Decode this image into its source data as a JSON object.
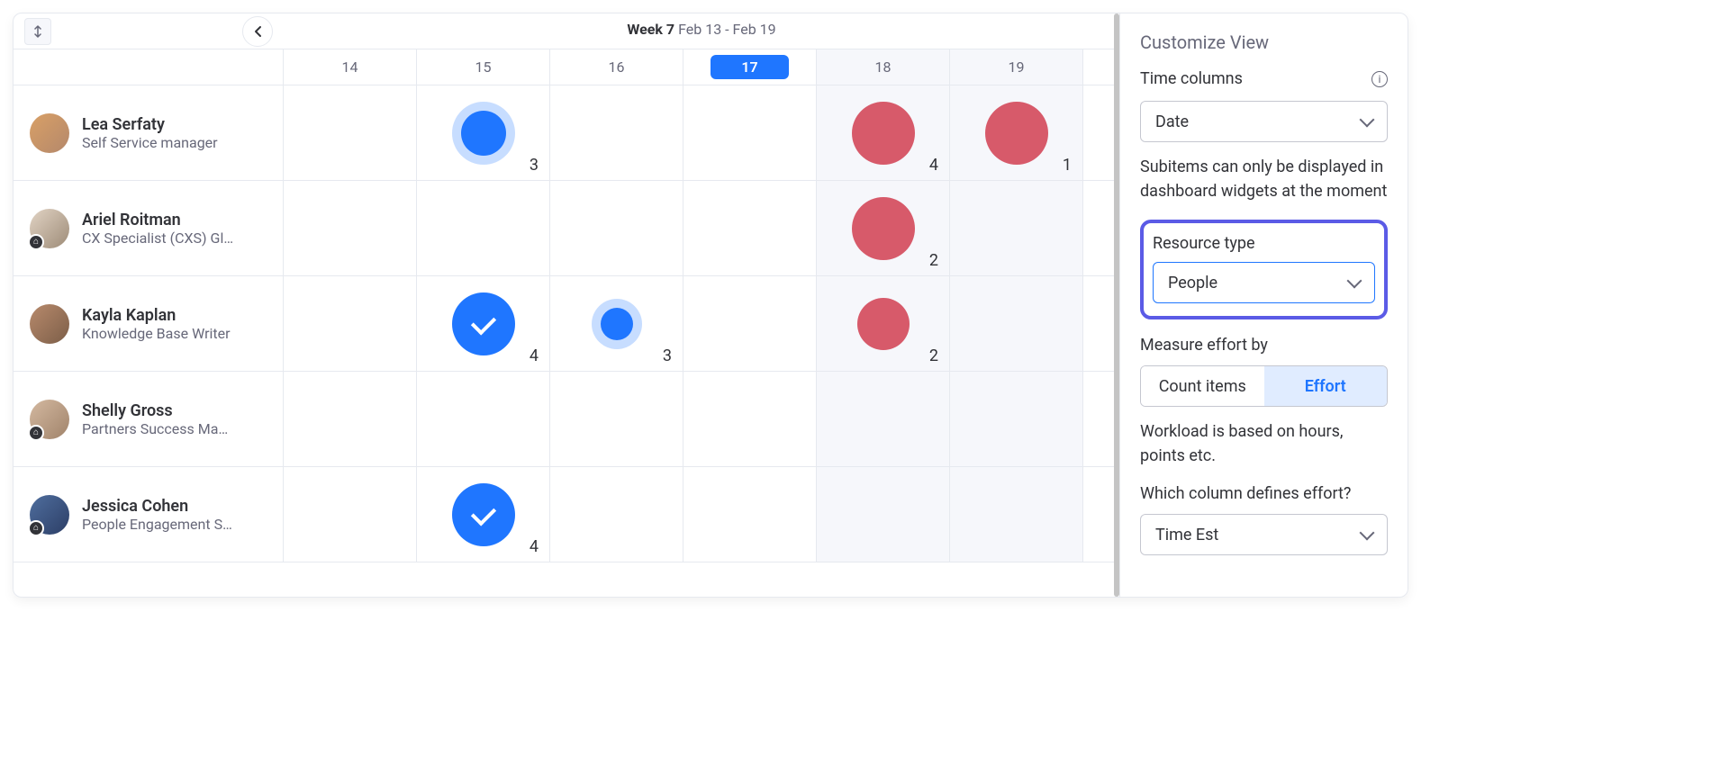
{
  "header": {
    "week_label": "Week 7",
    "range_label": "Feb 13 - Feb 19",
    "days": [
      {
        "num": "14",
        "weekend": false,
        "today": false
      },
      {
        "num": "15",
        "weekend": false,
        "today": false
      },
      {
        "num": "16",
        "weekend": false,
        "today": false
      },
      {
        "num": "17",
        "weekend": false,
        "today": true
      },
      {
        "num": "18",
        "weekend": true,
        "today": false
      },
      {
        "num": "19",
        "weekend": true,
        "today": false
      }
    ]
  },
  "people": [
    {
      "name": "Lea Serfaty",
      "role": "Self Service manager",
      "home_badge": false,
      "avatar": "a1",
      "cells": [
        {},
        {
          "dot": {
            "color": "blue",
            "size": "sz50",
            "ring": true
          },
          "count": "3"
        },
        {},
        {},
        {
          "dot": {
            "color": "red",
            "size": "sz70"
          },
          "count": "4",
          "weekend": true
        },
        {
          "dot": {
            "color": "red",
            "size": "sz70"
          },
          "count": "1",
          "weekend": true
        }
      ]
    },
    {
      "name": "Ariel Roitman",
      "role": "CX Specialist (CXS) Gl…",
      "home_badge": true,
      "avatar": "a2",
      "cells": [
        {},
        {},
        {},
        {},
        {
          "dot": {
            "color": "red",
            "size": "sz70"
          },
          "count": "2",
          "weekend": true
        },
        {
          "weekend": true
        }
      ]
    },
    {
      "name": "Kayla Kaplan",
      "role": "Knowledge Base Writer",
      "home_badge": false,
      "avatar": "a3",
      "cells": [
        {},
        {
          "dot": {
            "color": "blue",
            "size": "sz70",
            "check": true
          },
          "count": "4"
        },
        {
          "dot": {
            "color": "blue",
            "size": "sz36",
            "ring": true
          },
          "count": "3"
        },
        {},
        {
          "dot": {
            "color": "red",
            "size": "sz58"
          },
          "count": "2",
          "weekend": true
        },
        {
          "weekend": true
        }
      ]
    },
    {
      "name": "Shelly Gross",
      "role": "Partners Success Ma…",
      "home_badge": true,
      "avatar": "a4",
      "cells": [
        {},
        {},
        {},
        {},
        {
          "weekend": true
        },
        {
          "weekend": true
        }
      ]
    },
    {
      "name": "Jessica Cohen",
      "role": "People Engagement S…",
      "home_badge": true,
      "avatar": "a5",
      "cells": [
        {},
        {
          "dot": {
            "color": "blue",
            "size": "sz70",
            "check": true
          },
          "count": "4"
        },
        {},
        {},
        {
          "weekend": true
        },
        {
          "weekend": true
        }
      ]
    }
  ],
  "sidebar": {
    "title": "Customize View",
    "time_columns_label": "Time columns",
    "time_columns_value": "Date",
    "subitems_note": "Subitems can only be displayed in dashboard widgets at the moment",
    "resource_type_label": "Resource type",
    "resource_type_value": "People",
    "measure_label": "Measure effort by",
    "measure_options": {
      "count": "Count items",
      "effort": "Effort"
    },
    "measure_note": "Workload is based on hours, points etc.",
    "effort_col_label": "Which column defines effort?",
    "effort_col_value": "Time Est"
  }
}
